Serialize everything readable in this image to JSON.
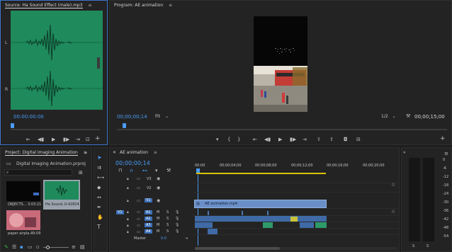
{
  "source": {
    "title": "Source: Ha Sound Effect (male).mp3",
    "menu_icon": "hamburger-icon",
    "channel_labels": [
      "L",
      "R"
    ],
    "timecode": "00:00:00:00"
  },
  "program": {
    "title": "Program: AE animation",
    "timecode": "00;00;00;14",
    "fit_label": "Fit",
    "resolution": "1/2",
    "duration": "00;00;15;00"
  },
  "project": {
    "title": "Project: Digital Imaging Animation",
    "overflow": "»",
    "file_name": "Digital Imaging Animation.prproj",
    "items": [
      {
        "name": "OBJECTS...",
        "duration": "3:03:21"
      },
      {
        "name": "Ha Sound...",
        "duration": "0:42824"
      },
      {
        "name": "paper airpla...",
        "duration": "49:09"
      }
    ]
  },
  "timeline": {
    "title": "AE animation",
    "timecode": "00;00;00;14",
    "ruler": [
      "00;00",
      "00;00;04;00",
      "00;00;08;00",
      "00;00;12;00",
      "00;00;16;00",
      "00;00;20;00"
    ],
    "video_tracks": [
      "V3",
      "V2",
      "V1"
    ],
    "audio_tracks": [
      "A1",
      "A2",
      "A3",
      "A4"
    ],
    "source_patch_video": "V1",
    "source_patch_audio": "A1",
    "clip_label": "AE animation.mp4",
    "master_label": "Master",
    "master_value": "0.0",
    "m_label": "M",
    "s_label": "S"
  },
  "meter": {
    "scale": [
      "0",
      "-6",
      "-12",
      "-18",
      "-24",
      "-30",
      "-36",
      "-42",
      "-48",
      "-54"
    ],
    "solo_labels": [
      "S",
      "S"
    ]
  },
  "colors": {
    "accent": "#4a9cf5",
    "waveform_bg": "#1f8a5c",
    "clip_blue": "#6a8fc8",
    "audio_clip": "#3f6aa6",
    "green_clip": "#2e9a6a",
    "work_area": "#d9c300"
  }
}
